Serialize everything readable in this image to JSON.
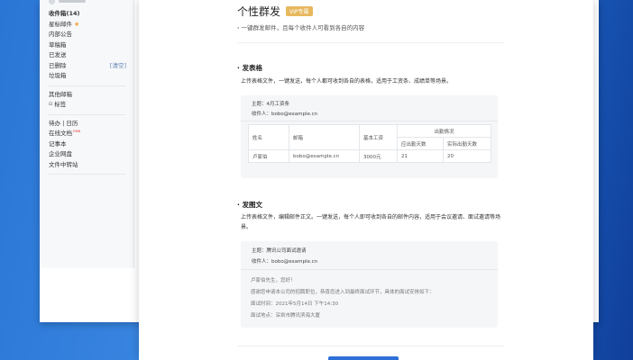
{
  "sidebar": {
    "groups": [
      [
        {
          "label": "收件箱(14)",
          "bold": true
        },
        {
          "label": "星标邮件",
          "star": "★"
        },
        {
          "label": "内部公告"
        },
        {
          "label": "草稿箱"
        },
        {
          "label": "已发送"
        },
        {
          "label": "已删除",
          "right": "[清空]"
        },
        {
          "label": "垃圾箱"
        }
      ],
      [
        {
          "label": "其他邮箱"
        },
        {
          "label": "标签",
          "tree": "⊟"
        }
      ],
      [
        {
          "label": "待办 | 日历"
        },
        {
          "label": "在线文档",
          "badge": "new"
        },
        {
          "label": "记事本"
        },
        {
          "label": "企业网盘"
        },
        {
          "label": "文件中转站"
        }
      ]
    ]
  },
  "modal": {
    "title": "个性群发",
    "vip": "VIP专属",
    "subtitle": "一键群发邮件，且每个收件人可看到各自的内容",
    "sections": {
      "table": {
        "title": "发表格",
        "desc": "上传表格文件，一键发送，每个人都可收到各自的表格，适用于工资条、成绩单等场景。",
        "subject": "主题：4月工资条",
        "recipient": "收件人：bobo@example.cn",
        "headers": [
          "姓名",
          "邮箱",
          "基本工资",
          "出勤情况",
          "应出勤天数",
          "实际出勤天数"
        ],
        "row": [
          "卢家伯",
          "bobo@example.cn",
          "3000元",
          "21",
          "20"
        ]
      },
      "text": {
        "title": "发图文",
        "desc": "上传表格文件，编辑邮件正文。一键发送，每个人即可收到各自的邮件内容，适用于会议邀请、面试邀请等场景。",
        "subject": "主题：腾讯公司面试邀请",
        "recipient": "收件人：bobo@example.cn",
        "lines": [
          "卢家伯先生，您好！",
          "感谢您申请本公司的招聘职位，恭喜您进入到最终面试环节，具体的面试安排如下：",
          "面试时间：2021年5月14日 下午14:30",
          "面试地点：深圳市腾讯滨海大厦"
        ]
      }
    }
  },
  "colors": {
    "vip": "#e7b85e",
    "accent": "#2e6fd8",
    "background": "#2a76d6"
  }
}
